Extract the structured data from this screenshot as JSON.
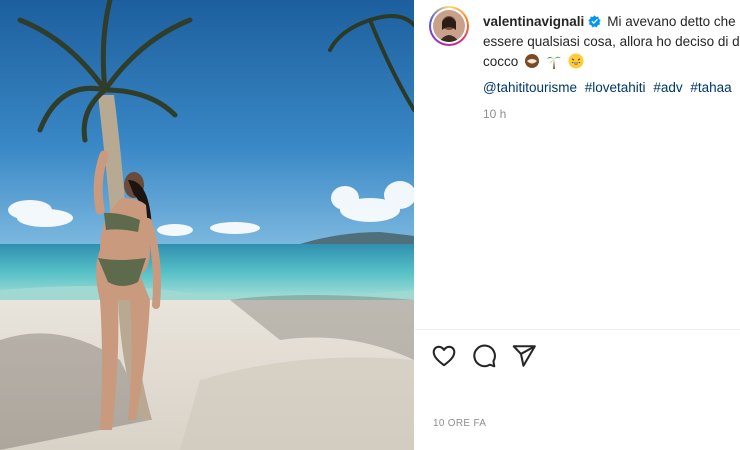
{
  "post": {
    "username": "valentinavignali",
    "caption_line1": "Mi avevano detto che",
    "caption_line2": "essere qualsiasi cosa, allora ho deciso di d",
    "caption_line3": "cocco",
    "emojis": [
      "coconut-emoji",
      "palm-tree-emoji",
      "grinning-emoji"
    ],
    "hashtags": [
      "@tahititourisme",
      "#lovetahiti",
      "#adv",
      "#tahaa"
    ],
    "time_short": "10 h",
    "time_full": "10 ORE FA"
  },
  "icons": {
    "like": "heart-icon",
    "comment": "comment-icon",
    "share": "share-icon",
    "verified": "verified-badge-icon"
  },
  "colors": {
    "link": "#00376b",
    "muted": "#8e8e8e",
    "verified": "#0095f6"
  }
}
